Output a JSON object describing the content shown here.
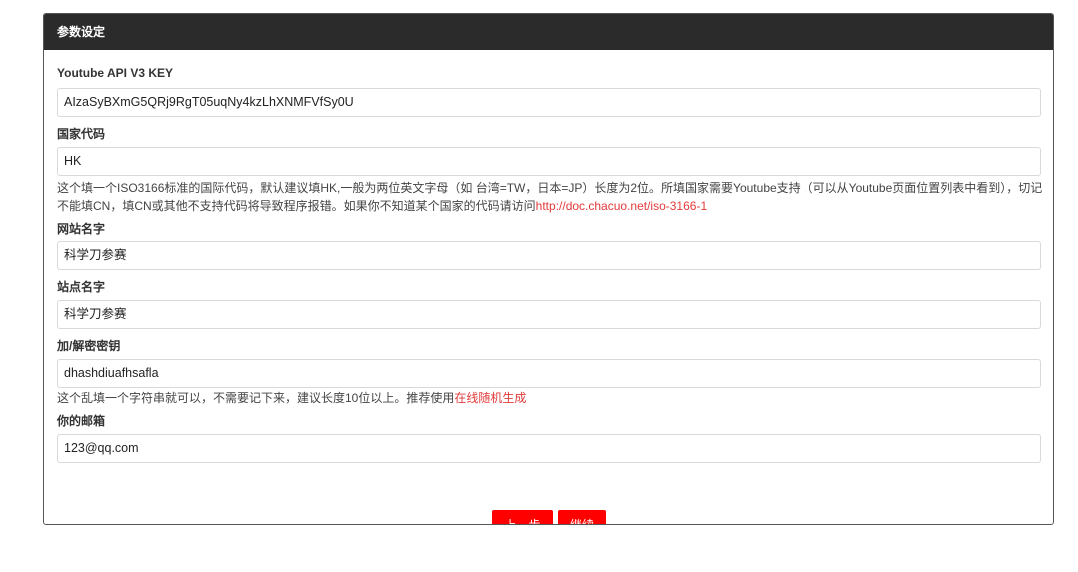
{
  "panel": {
    "title": "参数设定"
  },
  "fields": {
    "api_key": {
      "label": "Youtube API V3 KEY",
      "value": "AIzaSyBXmG5QRj9RgT05uqNy4kzLhXNMFVfSy0U"
    },
    "country": {
      "label": "国家代码",
      "value": "HK",
      "help_text": "这个填一个ISO3166标准的国际代码，默认建议填HK,一般为两位英文字母（如 台湾=TW，日本=JP）长度为2位。所填国家需要Youtube支持（可以从Youtube页面位置列表中看到），切记不能填CN，填CN或其他不支持代码将导致程序报错。如果你不知道某个国家的代码请访问",
      "help_link": "http://doc.chacuo.net/iso-3166-1"
    },
    "site_name": {
      "label": "网站名字",
      "value": "科学刀参赛"
    },
    "station_name": {
      "label": "站点名字",
      "value": "科学刀参赛"
    },
    "secret": {
      "label": "加/解密密钥",
      "value": "dhashdiuafhsafla",
      "help_text": "这个乱填一个字符串就可以，不需要记下来，建议长度10位以上。推荐使用",
      "help_link": "在线随机生成"
    },
    "email": {
      "label": "你的邮箱",
      "value": "123@qq.com"
    }
  },
  "buttons": {
    "prev": "上一步",
    "next": "继续"
  },
  "colors": {
    "header_bg": "#2b2b2b",
    "button_bg": "#ff0000",
    "link": "#e23a3a"
  }
}
